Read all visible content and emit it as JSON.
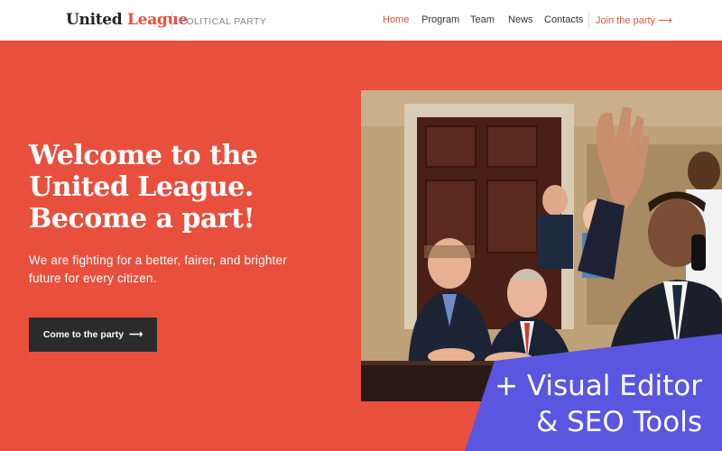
{
  "header": {
    "logo_part1": "United",
    "logo_part2": "League",
    "tagline": "POLITICAL PARTY",
    "nav": [
      {
        "label": "Home"
      },
      {
        "label": "Program"
      },
      {
        "label": "Team"
      },
      {
        "label": "News"
      },
      {
        "label": "Contacts"
      }
    ],
    "join_label": "Join the party",
    "join_icon": "arrow-right-icon"
  },
  "hero": {
    "title_lines": [
      "Welcome to the",
      "United League.",
      "Become a part!"
    ],
    "subtitle_lines": [
      "We are fighting for a better, fairer, and brighter",
      "future for every citizen."
    ],
    "cta_label": "Come to the party",
    "cta_icon": "arrow-right-icon"
  },
  "promo": {
    "line1": "+ Visual Editor",
    "line2": "& SEO Tools"
  },
  "colors": {
    "accent": "#e8503c",
    "hero_bg": "#e8503d",
    "cta_bg": "#2b2b2b",
    "promo_bg": "#5b56e0"
  }
}
